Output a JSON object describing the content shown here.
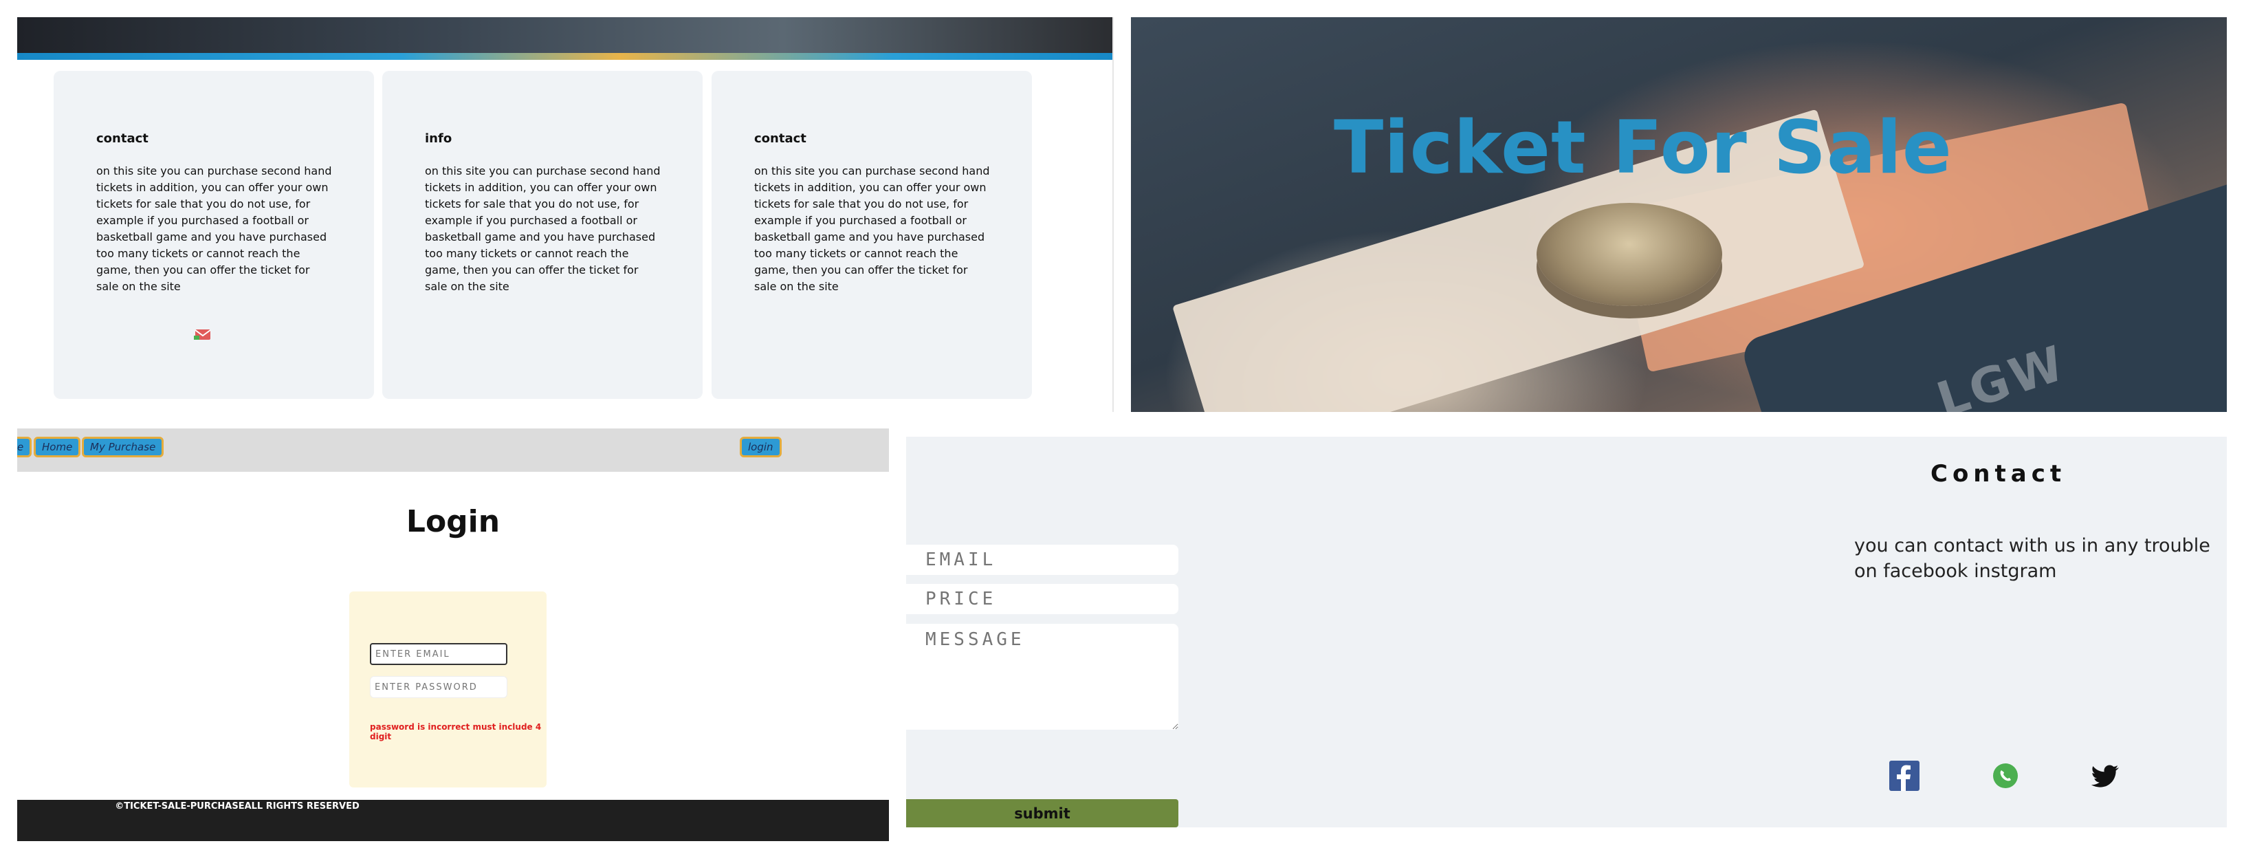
{
  "cards": [
    {
      "title": "contact",
      "text": "on this site you can purchase second hand tickets in addition, you can offer your own tickets for sale that you do not use, for example if you purchased a football or basketball game and you have purchased too many tickets or cannot reach the game, then you can offer the ticket for sale on the site",
      "icon": "envelope-icon"
    },
    {
      "title": "info",
      "text": "on this site you can purchase second hand tickets in addition, you can offer your own tickets for sale that you do not use, for example if you purchased a football or basketball game and you have purchased too many tickets or cannot reach the game, then you can offer the ticket for sale on the site"
    },
    {
      "title": "contact",
      "text": "on this site you can purchase second hand tickets in addition, you can offer your own tickets for sale that you do not use, for example if you purchased a football or basketball game and you have purchased too many tickets or cannot reach the game, then you can offer the ticket for sale on the site"
    }
  ],
  "hero": {
    "title": "Ticket For Sale"
  },
  "login_page": {
    "nav": {
      "partial": "e",
      "home": "Home",
      "my_purchase": "My Purchase",
      "login": "login"
    },
    "title": "Login",
    "email_placeholder": "ENTER EMAIL",
    "password_placeholder": "ENTER PASSWORD",
    "error": "password is incorrect must include 4 digit",
    "footer": "©TICKET-SALE-PURCHASEALL RIGHTS RESERVED"
  },
  "contact_form": {
    "email_placeholder": "EMAIL",
    "price_placeholder": "PRICE",
    "message_placeholder": "MESSAGE",
    "submit": "submit",
    "heading": "Contact",
    "description": "you can contact with us in any trouble on facebook instgram",
    "social": [
      "facebook-icon",
      "whatsapp-icon",
      "twitter-icon"
    ]
  },
  "colors": {
    "accent_blue": "#2891c4",
    "nav_button": "#2d9ad4",
    "nav_border": "#e5ac3c",
    "submit_green": "#6e8a3e",
    "error_red": "#e02020"
  }
}
